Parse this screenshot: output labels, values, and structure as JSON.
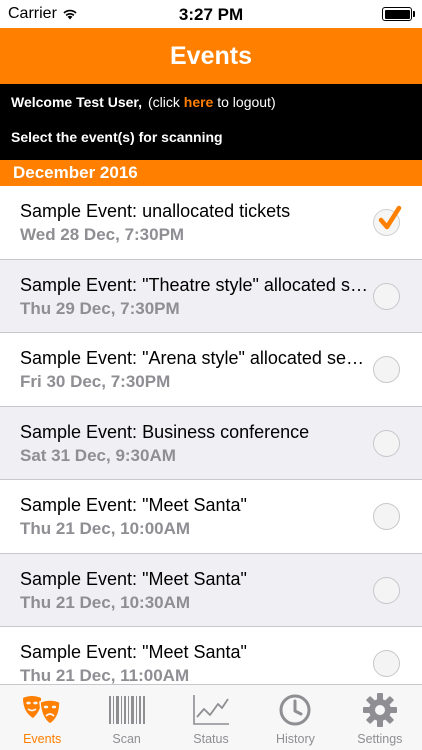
{
  "status_bar": {
    "carrier": "Carrier",
    "time": "3:27 PM",
    "wifi_icon": "wifi-icon",
    "battery_icon": "battery-icon"
  },
  "nav": {
    "title": "Events"
  },
  "welcome": {
    "greeting": "Welcome Test User,",
    "click_prefix": "(click",
    "link_text": "here",
    "link_suffix": "to logout)",
    "instruction": "Select the event(s) for scanning"
  },
  "section": {
    "title": "December 2016"
  },
  "events": [
    {
      "name": "Sample Event: unallocated tickets",
      "date": "Wed 28 Dec, 7:30PM",
      "selected": true
    },
    {
      "name": "Sample Event: \"Theatre style\" allocated seating",
      "date": "Thu 29 Dec, 7:30PM",
      "selected": false
    },
    {
      "name": "Sample Event: \"Arena style\" allocated seating",
      "date": "Fri 30 Dec, 7:30PM",
      "selected": false
    },
    {
      "name": "Sample Event: Business conference",
      "date": "Sat 31 Dec, 9:30AM",
      "selected": false
    },
    {
      "name": "Sample Event: \"Meet Santa\"",
      "date": "Thu 21 Dec, 10:00AM",
      "selected": false
    },
    {
      "name": "Sample Event: \"Meet Santa\"",
      "date": "Thu 21 Dec, 10:30AM",
      "selected": false
    },
    {
      "name": "Sample Event: \"Meet Santa\"",
      "date": "Thu 21 Dec, 11:00AM",
      "selected": false
    }
  ],
  "tabs": [
    {
      "label": "Events",
      "icon": "theatre-masks-icon",
      "active": true
    },
    {
      "label": "Scan",
      "icon": "barcode-icon",
      "active": false
    },
    {
      "label": "Status",
      "icon": "line-chart-icon",
      "active": false
    },
    {
      "label": "History",
      "icon": "clock-icon",
      "active": false
    },
    {
      "label": "Settings",
      "icon": "gear-icon",
      "active": false
    }
  ],
  "colors": {
    "accent": "#ff7f00",
    "header_black": "#000000",
    "row_alt": "#efeff4",
    "date_gray": "#8e8e93",
    "tab_inactive": "#8e8e93"
  }
}
